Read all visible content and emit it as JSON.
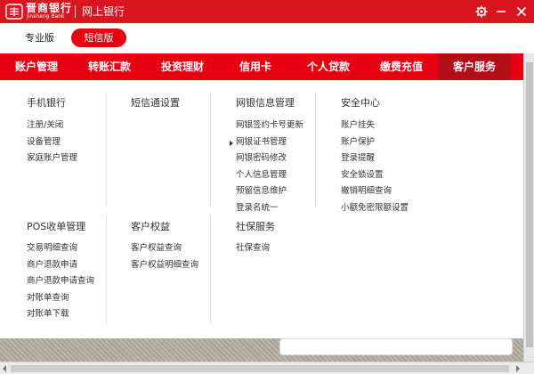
{
  "titlebar": {
    "logo_cn": "晋商银行",
    "logo_en": "Jinshang Bank",
    "window_title": "网上银行",
    "gear_icon": "gear-icon",
    "minimize_icon": "minimize-icon",
    "close_icon": "close-icon",
    "bg_color": "#d9151f"
  },
  "modes": {
    "pro_label": "专业版",
    "sms_label": "短信版",
    "active": "短信版",
    "active_color": "#e60012"
  },
  "nav": {
    "items": [
      {
        "label": "账户管理"
      },
      {
        "label": "转账汇款"
      },
      {
        "label": "投资理财"
      },
      {
        "label": "信用卡"
      },
      {
        "label": "个人贷款"
      },
      {
        "label": "缴费充值"
      },
      {
        "label": "客户服务"
      }
    ],
    "active": "客户服务",
    "color": "#e60012",
    "active_color": "#b30e18"
  },
  "menu": {
    "top": [
      {
        "heading": "手机银行",
        "items": [
          "注册/关闭",
          "设备管理",
          "家庭账户管理"
        ]
      },
      {
        "heading": "短信通设置",
        "items": []
      },
      {
        "heading": "网银信息管理",
        "items": [
          "网银签约卡号更新",
          "网银证书管理",
          "网银密码修改",
          "个人信息管理",
          "预留信息维护",
          "登录名统一"
        ]
      },
      {
        "heading": "安全中心",
        "items": [
          "账户挂失",
          "账户保护",
          "登录提醒",
          "安全锁设置",
          "撤销明细查询",
          "小额免密限额设置"
        ]
      }
    ],
    "bottom": [
      {
        "heading": "POS收单管理",
        "items": [
          "交易明细查询",
          "商户退款申请",
          "商户退款申请查询",
          "对账单查询",
          "对账单下载"
        ]
      },
      {
        "heading": "客户权益",
        "items": [
          "客户权益查询",
          "客户权益明细查询"
        ]
      },
      {
        "heading": "社保服务",
        "items": [
          "社保查询"
        ]
      }
    ],
    "hovered_item": "网银证书管理"
  }
}
